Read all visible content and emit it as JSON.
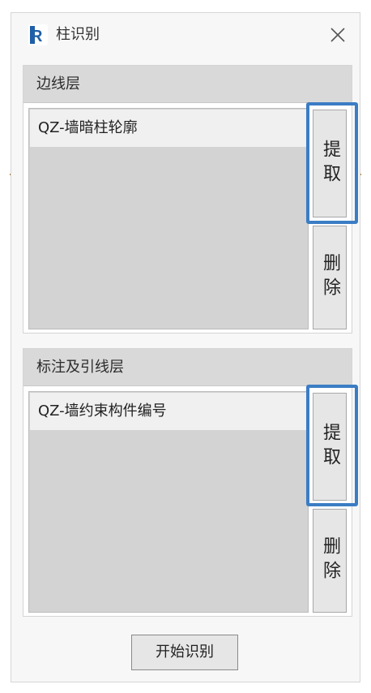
{
  "window": {
    "title": "柱识别",
    "app_icon_letter": "R",
    "accent_color": "#3b7dc4"
  },
  "edge_layer": {
    "label": "边线层",
    "items": [
      "QZ-墙暗柱轮廓"
    ],
    "extract_label": "提取",
    "delete_label": "删除"
  },
  "annotation_layer": {
    "label": "标注及引线层",
    "items": [
      "QZ-墙约束构件编号"
    ],
    "extract_label": "提取",
    "delete_label": "删除"
  },
  "footer": {
    "start_label": "开始识别"
  }
}
